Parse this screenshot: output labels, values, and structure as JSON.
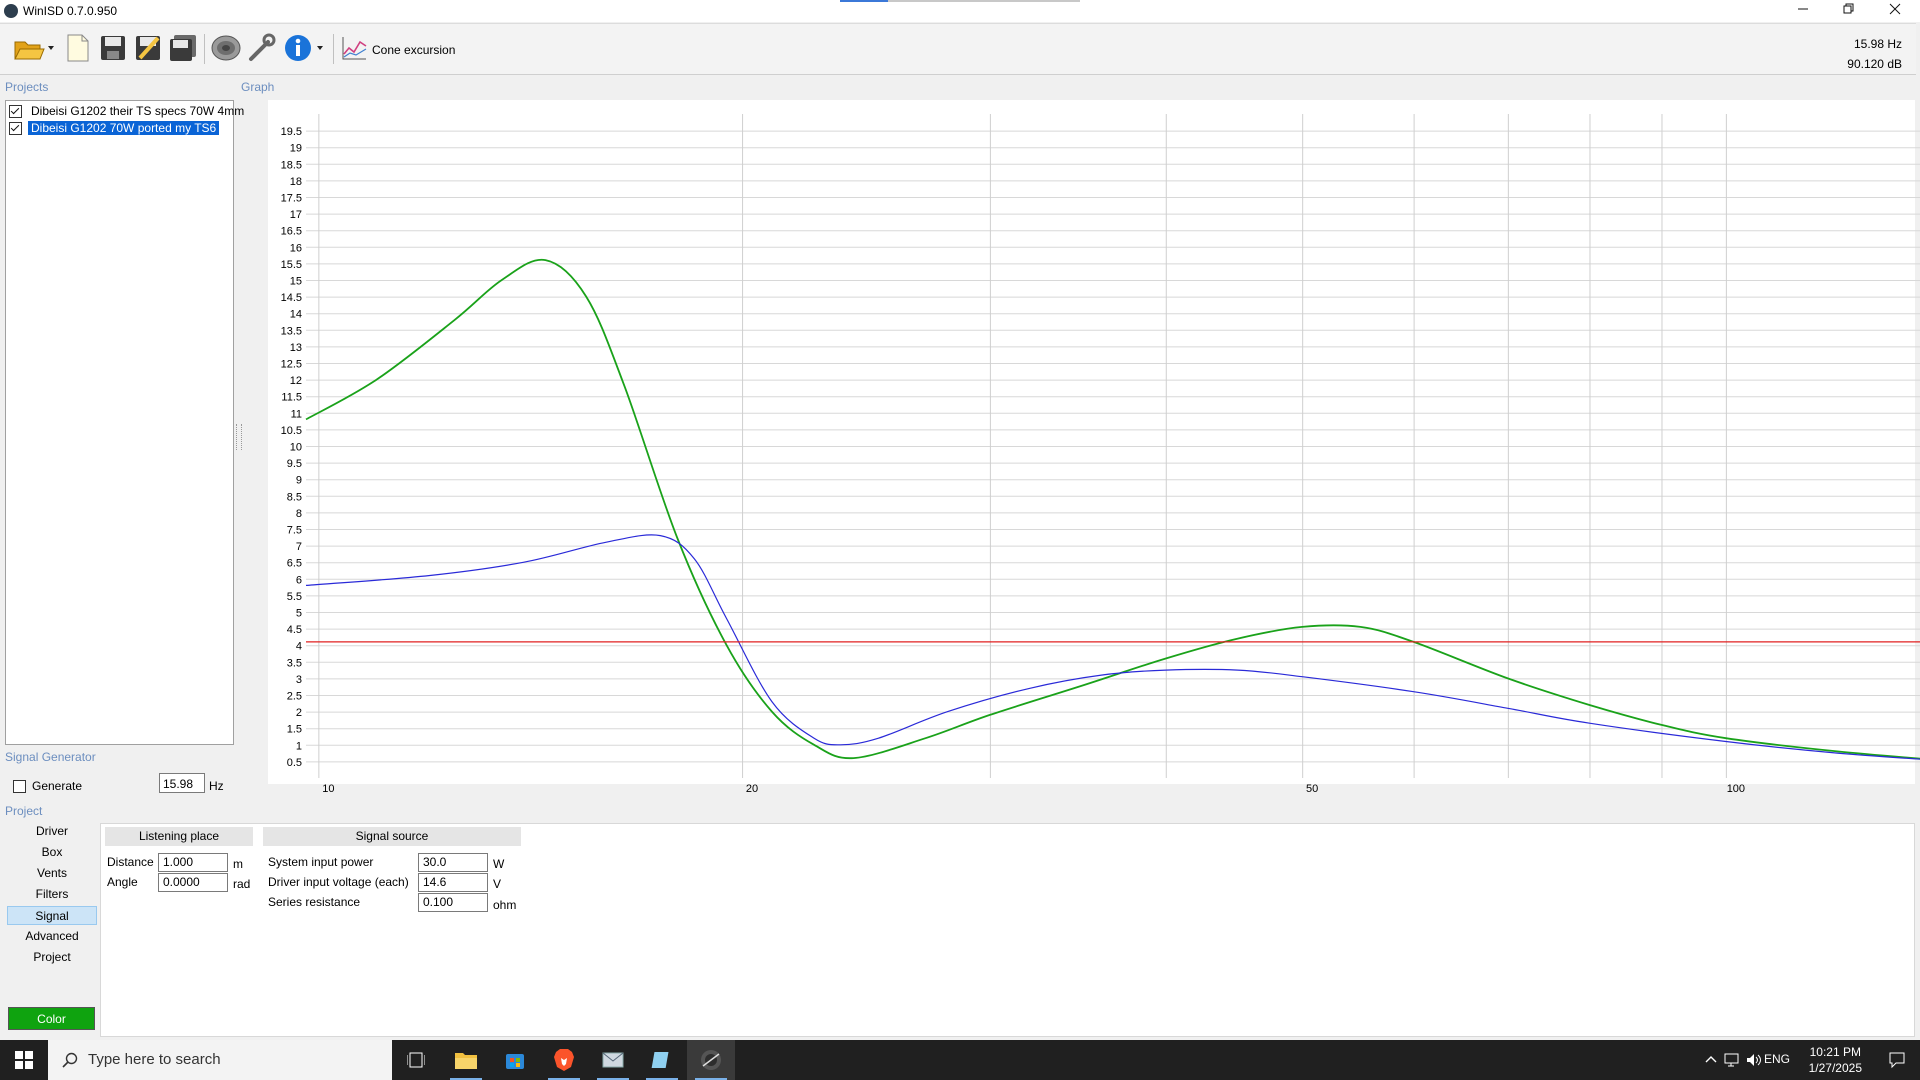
{
  "window": {
    "title": "WinISD 0.7.0.950",
    "progress_fraction": 0.2,
    "minimize_icon": "minimize-icon",
    "maximize_icon": "restore-icon",
    "close_icon": "close-icon"
  },
  "toolbar": {
    "buttons": [
      "open-folder-icon",
      "new-project-icon",
      "save-icon",
      "save-as-icon",
      "save-all-icon",
      "driver-editor-icon",
      "tools-icon",
      "info-icon"
    ],
    "graph_label": "Cone excursion",
    "freq_readout": "15.98 Hz",
    "level_readout": "90.120 dB"
  },
  "projects": {
    "label": "Projects",
    "items": [
      {
        "label": "Dibeisi G1202 their TS specs 70W 4mm",
        "checked": true,
        "selected": false
      },
      {
        "label": "Dibeisi G1202 70W ported my TS6",
        "checked": true,
        "selected": true
      }
    ]
  },
  "graph": {
    "label": "Graph"
  },
  "chart_data": {
    "type": "line",
    "x_scale": "log",
    "xlim": [
      9.8,
      145
    ],
    "ylim": [
      0,
      20
    ],
    "x_tick_labels": [
      "10",
      "20",
      "50",
      "100"
    ],
    "x_tick_values": [
      10,
      20,
      50,
      100
    ],
    "x_gridlines": [
      10,
      20,
      30,
      40,
      50,
      60,
      70,
      80,
      90,
      100
    ],
    "y_ticks": [
      0.5,
      1,
      1.5,
      2,
      2.5,
      3,
      3.5,
      4,
      4.5,
      5,
      5.5,
      6,
      6.5,
      7,
      7.5,
      8,
      8.5,
      9,
      9.5,
      10,
      10.5,
      11,
      11.5,
      12,
      12.5,
      13,
      13.5,
      14,
      14.5,
      15,
      15.5,
      16,
      16.5,
      17,
      17.5,
      18,
      18.5,
      19,
      19.5
    ],
    "grid": true,
    "series": [
      {
        "color": "#1aa21a",
        "x": [
          9.8,
          11,
          12.5,
          13.5,
          14.5,
          15.5,
          16.5,
          18,
          19.5,
          21,
          22.5,
          24,
          27,
          30,
          35,
          40,
          45,
          50,
          55,
          60,
          70,
          80,
          90,
          100,
          120,
          145
        ],
        "y": [
          10.8,
          12,
          13.8,
          15,
          15.6,
          14.5,
          11.8,
          7.2,
          4,
          2,
          1,
          0.6,
          1.2,
          1.9,
          2.8,
          3.6,
          4.2,
          4.55,
          4.55,
          4.1,
          3,
          2.2,
          1.6,
          1.2,
          0.8,
          0.5
        ]
      },
      {
        "color": "#2a2ad8",
        "x": [
          9.8,
          12,
          14,
          16,
          17.5,
          18.5,
          19.5,
          21,
          22.5,
          23.5,
          25,
          28,
          32,
          36,
          40,
          45,
          50,
          60,
          70,
          80,
          100,
          120,
          145
        ],
        "y": [
          5.8,
          6.1,
          6.5,
          7.1,
          7.3,
          6.6,
          4.8,
          2.3,
          1.2,
          1,
          1.2,
          2,
          2.7,
          3.1,
          3.25,
          3.25,
          3.05,
          2.6,
          2.1,
          1.65,
          1.1,
          0.75,
          0.5
        ]
      },
      {
        "color": "#e02020",
        "x": [
          9.8,
          145
        ],
        "y": [
          4.1,
          4.1
        ]
      }
    ]
  },
  "signal_generator": {
    "label": "Signal Generator",
    "generate_label": "Generate",
    "generate_checked": false,
    "freq_value": "15.98",
    "freq_unit": "Hz"
  },
  "project_panel": {
    "label": "Project",
    "nav": [
      "Driver",
      "Box",
      "Vents",
      "Filters",
      "Signal",
      "Advanced",
      "Project"
    ],
    "active_nav": "Signal",
    "color_button": "Color",
    "color_value": "#0fa30f",
    "listening_place": {
      "header": "Listening place",
      "distance_label": "Distance",
      "distance_value": "1.000",
      "distance_unit": "m",
      "angle_label": "Angle",
      "angle_value": "0.0000",
      "angle_unit": "rad"
    },
    "signal_source": {
      "header": "Signal source",
      "power_label": "System input power",
      "power_value": "30.0",
      "power_unit": "W",
      "voltage_label": "Driver input voltage (each)",
      "voltage_value": "14.6",
      "voltage_unit": "V",
      "resistance_label": "Series resistance",
      "resistance_value": "0.100",
      "resistance_unit": "ohm"
    }
  },
  "taskbar": {
    "search_placeholder": "Type here to search",
    "icons": [
      "windows-start-icon",
      "search-icon",
      "task-view-icon",
      "file-explorer-icon",
      "store-icon",
      "brave-icon",
      "mail-icon",
      "notepad-icon",
      "winisd-icon"
    ],
    "language": "ENG",
    "time": "10:21 PM",
    "date": "1/27/2025"
  }
}
